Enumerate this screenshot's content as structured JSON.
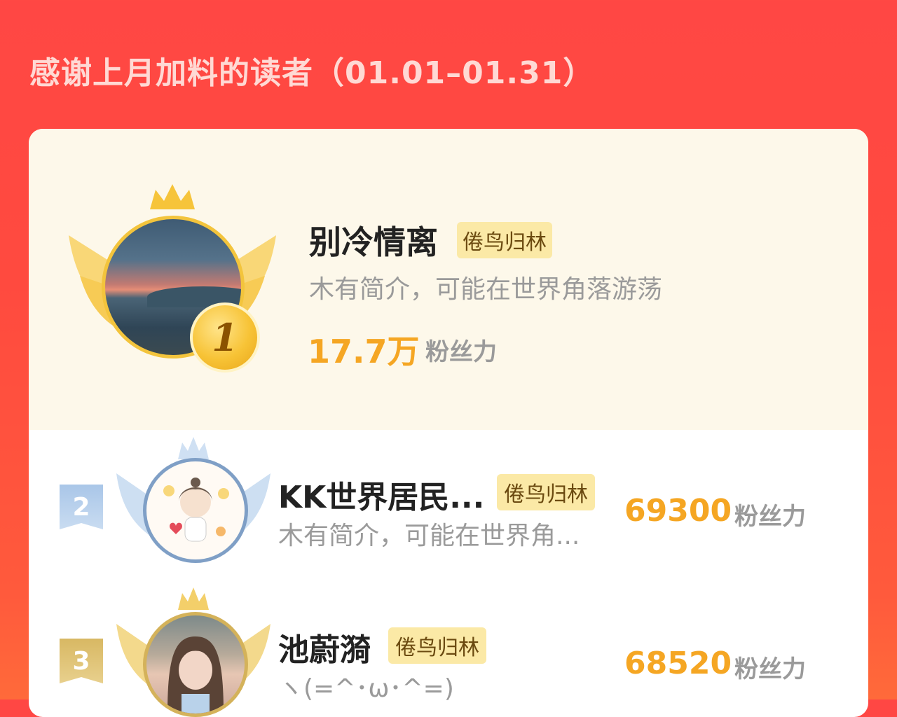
{
  "header": {
    "title": "感谢上月加料的读者（01.01–01.31）"
  },
  "colors": {
    "background": "#ff4744",
    "card_top": "#fdf8ea",
    "accent_gold": "#f5a623",
    "tag_bg": "#fbe9a6",
    "rank2_silver": "#a9c6e8",
    "rank3_bronze": "#d8b863"
  },
  "leaderboard": [
    {
      "rank": "1",
      "name": "别冷情离",
      "tag": "倦鸟归林",
      "bio": "木有简介，可能在世界角落游荡",
      "fans_value": "17.7万",
      "fans_label": "粉丝力",
      "avatar_icon": "sunset-sea-photo",
      "badge_icon": "gold-winged-crown-badge"
    },
    {
      "rank": "2",
      "name": "KK世界居民...",
      "tag": "倦鸟归林",
      "bio": "木有简介，可能在世界角...",
      "fans_value": "69300",
      "fans_label": "粉丝力",
      "avatar_icon": "cartoon-girl-illustration",
      "badge_icon": "silver-winged-crown-badge"
    },
    {
      "rank": "3",
      "name": "池蔚漪",
      "tag": "倦鸟归林",
      "bio": "ヽ(=^･ω･^=)",
      "fans_value": "68520",
      "fans_label": "粉丝力",
      "avatar_icon": "portrait-photo",
      "badge_icon": "bronze-winged-crown-badge"
    }
  ]
}
